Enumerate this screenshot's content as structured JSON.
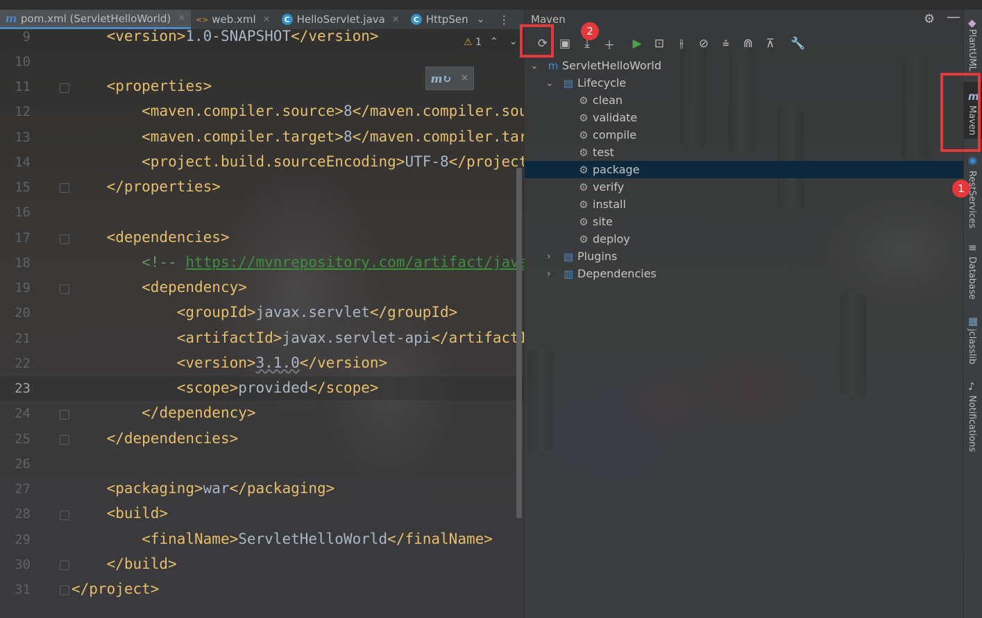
{
  "tabs": [
    {
      "label": "pom.xml (ServletHelloWorld)",
      "icon": "maven-icon",
      "active": true
    },
    {
      "label": "web.xml",
      "icon": "xml-file-icon"
    },
    {
      "label": "HelloServlet.java",
      "icon": "java-class-icon"
    },
    {
      "label": "HttpSen",
      "icon": "java-class-icon"
    }
  ],
  "editor": {
    "warnings": "1",
    "line_numbers": [
      "9",
      "10",
      "11",
      "12",
      "13",
      "14",
      "15",
      "16",
      "17",
      "18",
      "19",
      "20",
      "21",
      "22",
      "23",
      "24",
      "25",
      "26",
      "27",
      "28",
      "29",
      "30",
      "31"
    ],
    "current_line": "23"
  },
  "maven": {
    "title": "Maven",
    "project": "ServletHelloWorld",
    "lifecycle_label": "Lifecycle",
    "lifecycle": [
      "clean",
      "validate",
      "compile",
      "test",
      "package",
      "verify",
      "install",
      "site",
      "deploy"
    ],
    "selected": "package",
    "plugins_label": "Plugins",
    "dependencies_label": "Dependencies"
  },
  "side_tools": [
    "PlantUML",
    "Maven",
    "RestServices",
    "Database",
    "jclasslib",
    "Notifications"
  ],
  "annotations": {
    "badge1": "1",
    "badge2": "2"
  },
  "colors": {
    "highlight": "#e5383b",
    "tag": "#e8bf6a",
    "selection": "#0d293e"
  }
}
